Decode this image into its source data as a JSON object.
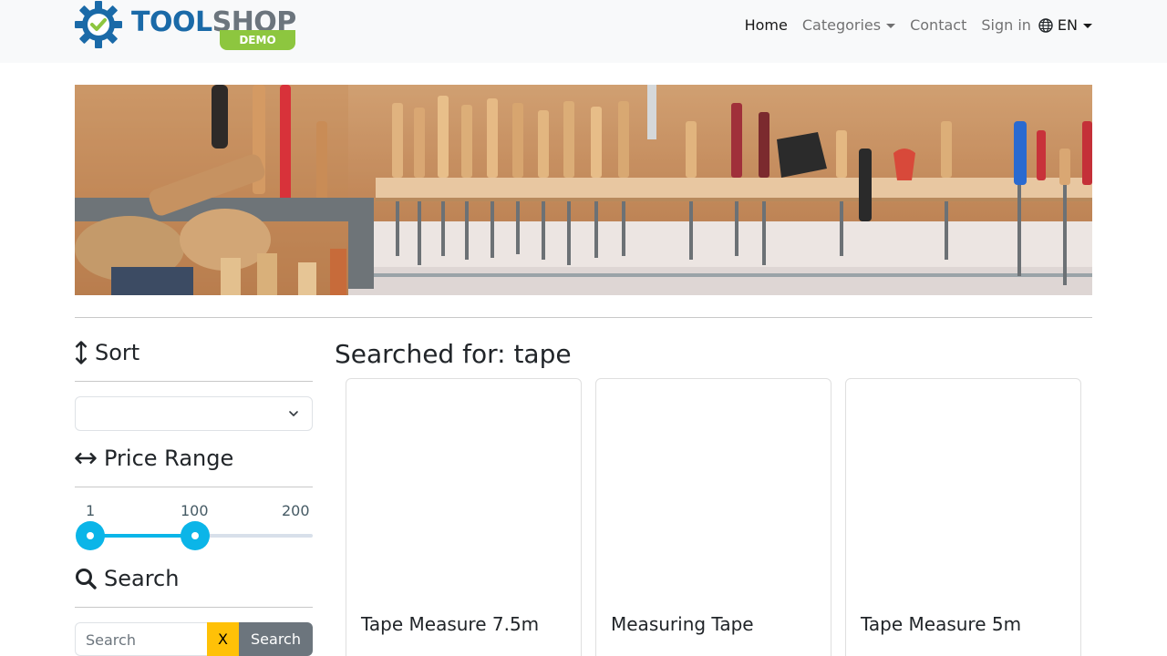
{
  "brand": {
    "tool": "TOOL",
    "shop": "SHOP",
    "badge": "DEMO",
    "colors": {
      "tool": "#1a6aa8",
      "shop": "#6c757d",
      "badge": "#8dc63f"
    }
  },
  "nav": {
    "home": "Home",
    "categories": "Categories",
    "contact": "Contact",
    "sign_in": "Sign in",
    "language": "EN"
  },
  "banner": {
    "icon": "tools-banner-image"
  },
  "sidebar": {
    "sort": {
      "title": "Sort",
      "icon": "sort-arrows-icon",
      "selected": ""
    },
    "price_range": {
      "title": "Price Range",
      "icon": "horizontal-arrows-icon",
      "min_label": "1",
      "current_label": "100",
      "max_label": "200",
      "min": 1,
      "max": 200,
      "value_low": 1,
      "value_high": 100,
      "accent": "#0bb5e8"
    },
    "search": {
      "title": "Search",
      "icon": "magnifier-icon",
      "placeholder": "Search",
      "value": "",
      "clear_label": "X",
      "submit_label": "Search"
    }
  },
  "main": {
    "heading": "Searched for: tape",
    "products": [
      {
        "name": "Tape Measure 7.5m"
      },
      {
        "name": "Measuring Tape"
      },
      {
        "name": "Tape Measure 5m"
      }
    ]
  }
}
